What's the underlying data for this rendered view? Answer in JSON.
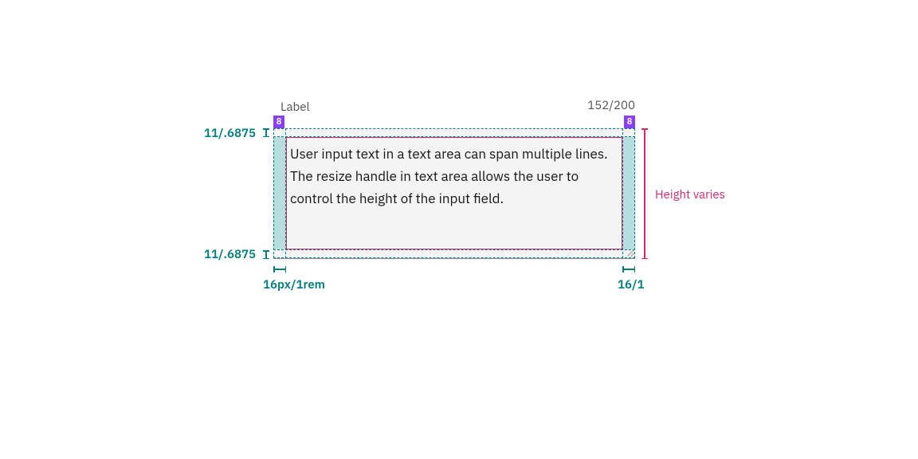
{
  "header": {
    "label": "Label",
    "count": "152/200",
    "badge_left": "8",
    "badge_right": "8"
  },
  "textarea": {
    "value": "User input text in a text area can span multiple lines. The resize handle in text area allows the user to control the height of the input field."
  },
  "annotations": {
    "pad_v_top": "11/.6875",
    "pad_v_bottom": "11/.6875",
    "pad_h_left": "16px/1rem",
    "pad_h_right": "16/1",
    "height_note": "Height varies"
  }
}
